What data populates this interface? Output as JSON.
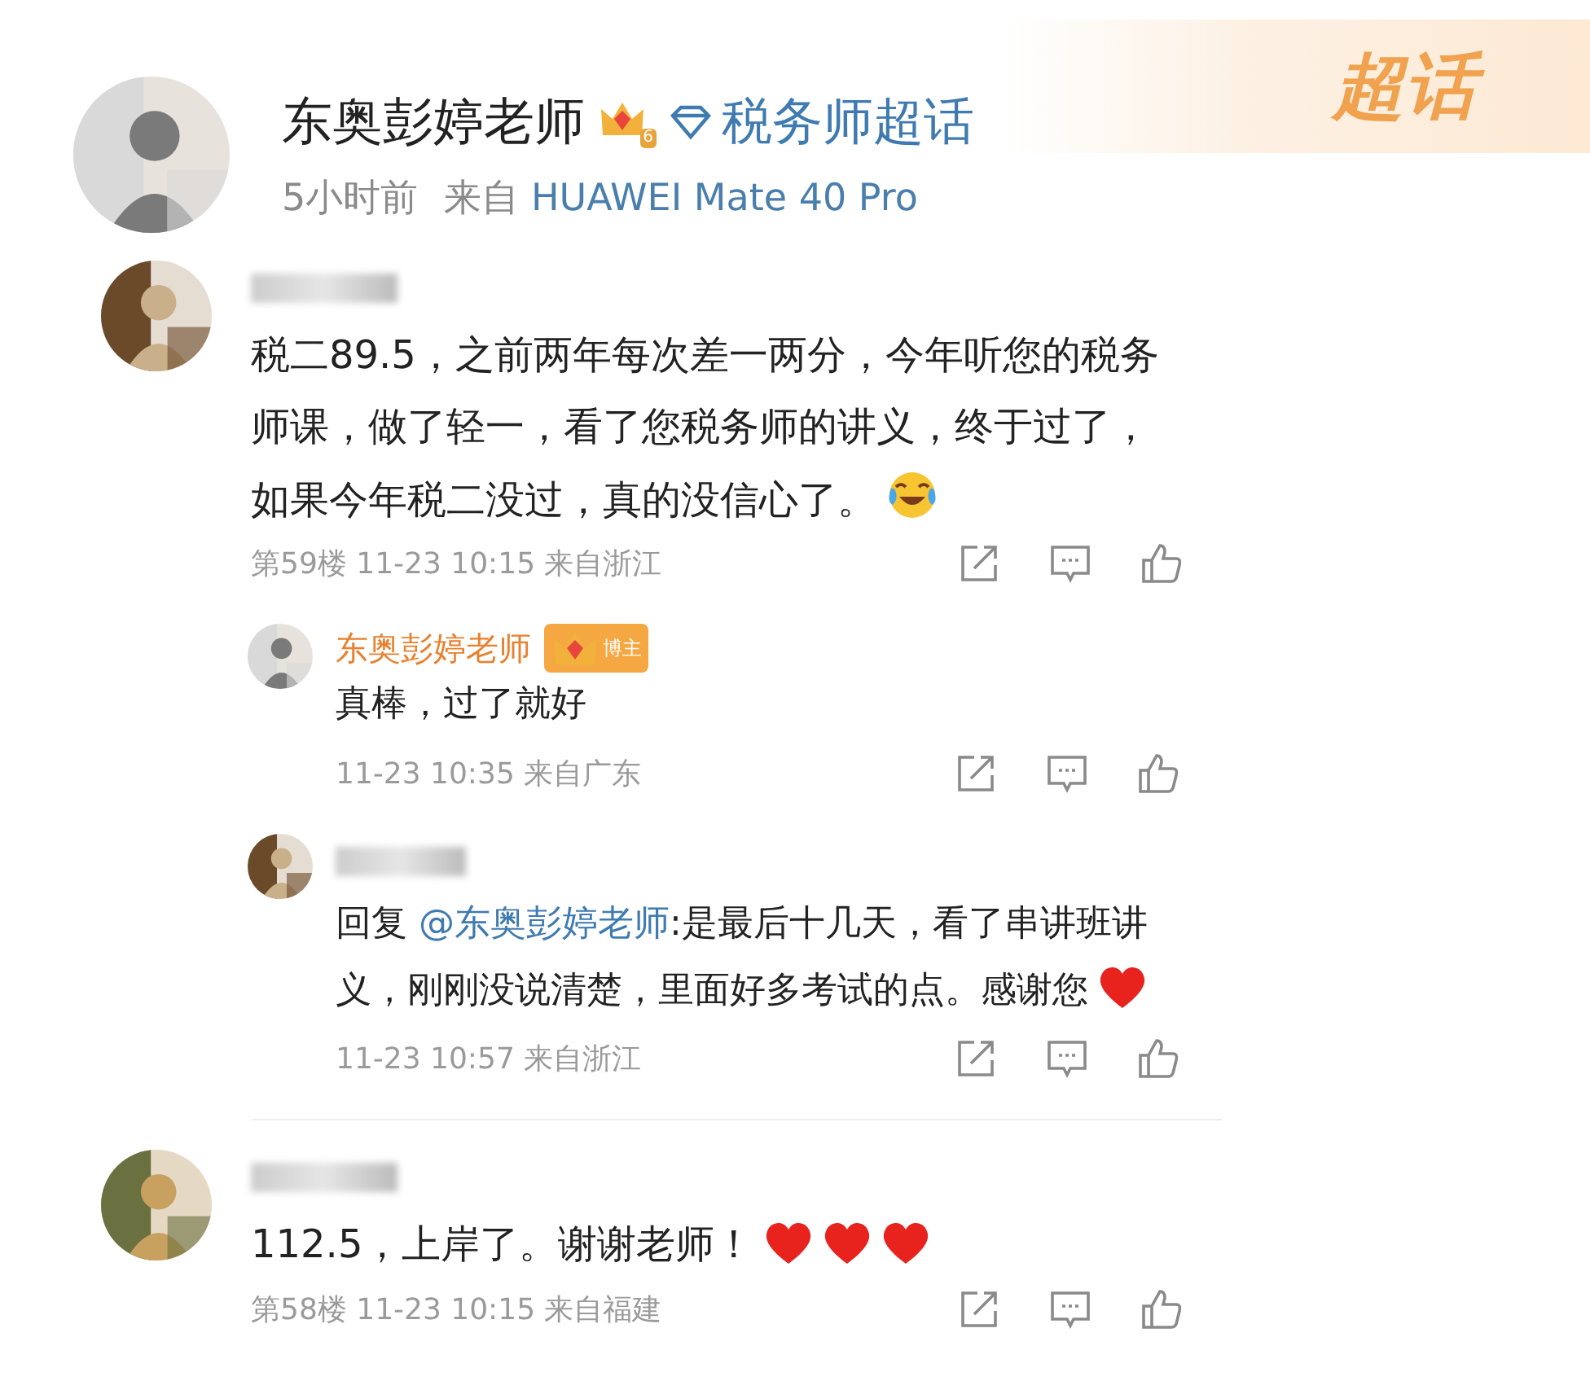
{
  "post": {
    "author": "东奥彭婷老师",
    "level_badge": "6",
    "topic": "税务师超话",
    "time": "5小时前",
    "source_prefix": "来自",
    "device": "HUAWEI Mate 40 Pro",
    "super_topic_logo": "超话"
  },
  "comments": [
    {
      "text": "税二89.5，之前两年每次差一两分，今年听您的税务师课，做了轻一，看了您税务师的讲义，终于过了，如果今年税二没过，真的没信心了。",
      "reactions": [
        {
          "kind": "laugh-cry"
        }
      ],
      "meta": "第59楼 11-23 10:15 来自浙江",
      "replies": [
        {
          "author": "东奥彭婷老师",
          "author_badge": "博主",
          "text": "真棒，过了就好",
          "meta": "11-23 10:35 来自广东"
        },
        {
          "prefix": "回复",
          "mention": "@东奥彭婷老师",
          "text": ":是最后十几天，看了串讲班讲义，刚刚没说清楚，里面好多考试的点。感谢您",
          "reactions": [
            {
              "kind": "heart"
            }
          ],
          "meta": "11-23 10:57 来自浙江"
        }
      ]
    },
    {
      "text": "112.5，上岸了。谢谢老师！",
      "reactions": [
        {
          "kind": "heart"
        },
        {
          "kind": "heart"
        },
        {
          "kind": "heart"
        }
      ],
      "meta": "第58楼 11-23 10:15 来自福建"
    }
  ]
}
